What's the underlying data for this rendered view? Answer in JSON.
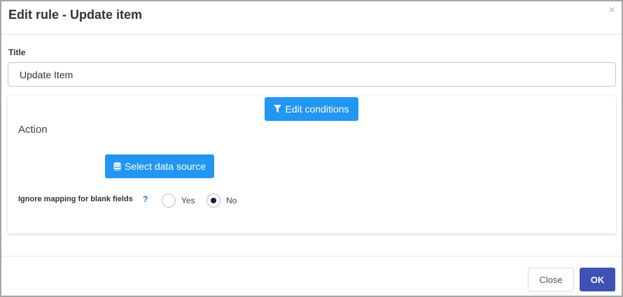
{
  "dialog": {
    "title": "Edit rule - Update item",
    "close_icon": "close-icon"
  },
  "form": {
    "title_label": "Title",
    "title_value": "Update Item"
  },
  "panel": {
    "edit_conditions_label": "Edit conditions",
    "edit_conditions_icon": "filter-icon",
    "action_heading": "Action",
    "select_data_source_label": "Select data source",
    "select_data_source_icon": "database-icon",
    "ignore_mapping_label": "Ignore mapping for blank fields",
    "help_label": "?",
    "radio_options": [
      {
        "label": "Yes",
        "checked": false
      },
      {
        "label": "No",
        "checked": true
      }
    ]
  },
  "footer": {
    "close_label": "Close",
    "ok_label": "OK"
  },
  "colors": {
    "primary_button": "#2196f3",
    "ok_button": "#3f51b5",
    "help_link": "#1a73c8"
  }
}
